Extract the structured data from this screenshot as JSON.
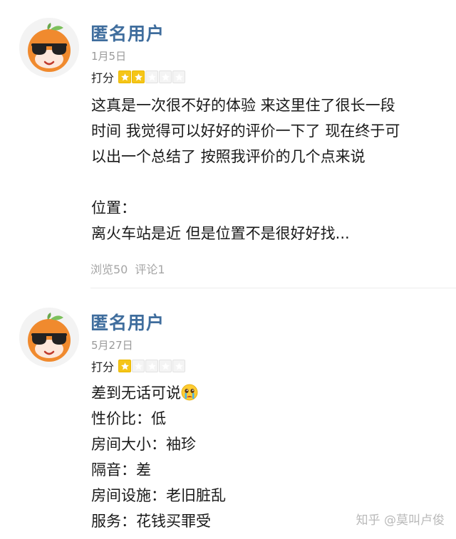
{
  "reviews": [
    {
      "username": "匿名用户",
      "date": "1月5日",
      "rating_label": "打分",
      "rating": 2,
      "rating_max": 5,
      "lines": [
        "这真是一次很不好的体验 来这里住了很长一段",
        "时间 我觉得可以好好的评价一下了 现在终于可",
        "以出一个总结了 按照我评价的几个点来说",
        "",
        "位置：",
        "离火车站是近 但是位置不是很好好找..."
      ],
      "views": "浏览50",
      "comments": "评论1"
    },
    {
      "username": "匿名用户",
      "date": "5月27日",
      "rating_label": "打分",
      "rating": 1,
      "rating_max": 5,
      "lines": [
        "差到无话可说",
        "性价比：低",
        "房间大小：袖珍",
        "隔音：差",
        "房间设施：老旧脏乱",
        "服务：花钱买罪受"
      ],
      "emoji": "crying-face-emoji"
    }
  ],
  "watermark": "知乎 @莫叫卢俊",
  "colors": {
    "username": "#3f6d9d",
    "star_filled": "#f5c518",
    "star_empty": "#f4f4f4",
    "muted": "#9a9a9a",
    "avatar_orange": "#f08a2e"
  }
}
